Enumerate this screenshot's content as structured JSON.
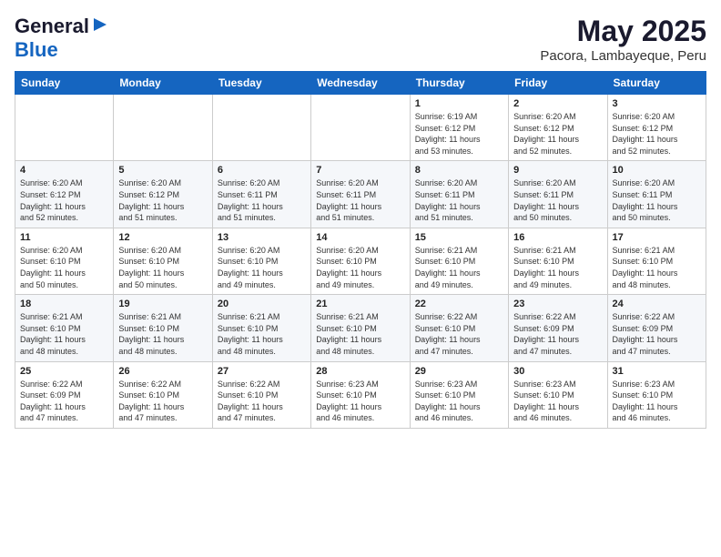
{
  "header": {
    "logo_line1": "General",
    "logo_line2": "Blue",
    "title": "May 2025",
    "subtitle": "Pacora, Lambayeque, Peru"
  },
  "days_of_week": [
    "Sunday",
    "Monday",
    "Tuesday",
    "Wednesday",
    "Thursday",
    "Friday",
    "Saturday"
  ],
  "weeks": [
    [
      {
        "day": "",
        "info": ""
      },
      {
        "day": "",
        "info": ""
      },
      {
        "day": "",
        "info": ""
      },
      {
        "day": "",
        "info": ""
      },
      {
        "day": "1",
        "info": "Sunrise: 6:19 AM\nSunset: 6:12 PM\nDaylight: 11 hours\nand 53 minutes."
      },
      {
        "day": "2",
        "info": "Sunrise: 6:20 AM\nSunset: 6:12 PM\nDaylight: 11 hours\nand 52 minutes."
      },
      {
        "day": "3",
        "info": "Sunrise: 6:20 AM\nSunset: 6:12 PM\nDaylight: 11 hours\nand 52 minutes."
      }
    ],
    [
      {
        "day": "4",
        "info": "Sunrise: 6:20 AM\nSunset: 6:12 PM\nDaylight: 11 hours\nand 52 minutes."
      },
      {
        "day": "5",
        "info": "Sunrise: 6:20 AM\nSunset: 6:12 PM\nDaylight: 11 hours\nand 51 minutes."
      },
      {
        "day": "6",
        "info": "Sunrise: 6:20 AM\nSunset: 6:11 PM\nDaylight: 11 hours\nand 51 minutes."
      },
      {
        "day": "7",
        "info": "Sunrise: 6:20 AM\nSunset: 6:11 PM\nDaylight: 11 hours\nand 51 minutes."
      },
      {
        "day": "8",
        "info": "Sunrise: 6:20 AM\nSunset: 6:11 PM\nDaylight: 11 hours\nand 51 minutes."
      },
      {
        "day": "9",
        "info": "Sunrise: 6:20 AM\nSunset: 6:11 PM\nDaylight: 11 hours\nand 50 minutes."
      },
      {
        "day": "10",
        "info": "Sunrise: 6:20 AM\nSunset: 6:11 PM\nDaylight: 11 hours\nand 50 minutes."
      }
    ],
    [
      {
        "day": "11",
        "info": "Sunrise: 6:20 AM\nSunset: 6:10 PM\nDaylight: 11 hours\nand 50 minutes."
      },
      {
        "day": "12",
        "info": "Sunrise: 6:20 AM\nSunset: 6:10 PM\nDaylight: 11 hours\nand 50 minutes."
      },
      {
        "day": "13",
        "info": "Sunrise: 6:20 AM\nSunset: 6:10 PM\nDaylight: 11 hours\nand 49 minutes."
      },
      {
        "day": "14",
        "info": "Sunrise: 6:20 AM\nSunset: 6:10 PM\nDaylight: 11 hours\nand 49 minutes."
      },
      {
        "day": "15",
        "info": "Sunrise: 6:21 AM\nSunset: 6:10 PM\nDaylight: 11 hours\nand 49 minutes."
      },
      {
        "day": "16",
        "info": "Sunrise: 6:21 AM\nSunset: 6:10 PM\nDaylight: 11 hours\nand 49 minutes."
      },
      {
        "day": "17",
        "info": "Sunrise: 6:21 AM\nSunset: 6:10 PM\nDaylight: 11 hours\nand 48 minutes."
      }
    ],
    [
      {
        "day": "18",
        "info": "Sunrise: 6:21 AM\nSunset: 6:10 PM\nDaylight: 11 hours\nand 48 minutes."
      },
      {
        "day": "19",
        "info": "Sunrise: 6:21 AM\nSunset: 6:10 PM\nDaylight: 11 hours\nand 48 minutes."
      },
      {
        "day": "20",
        "info": "Sunrise: 6:21 AM\nSunset: 6:10 PM\nDaylight: 11 hours\nand 48 minutes."
      },
      {
        "day": "21",
        "info": "Sunrise: 6:21 AM\nSunset: 6:10 PM\nDaylight: 11 hours\nand 48 minutes."
      },
      {
        "day": "22",
        "info": "Sunrise: 6:22 AM\nSunset: 6:10 PM\nDaylight: 11 hours\nand 47 minutes."
      },
      {
        "day": "23",
        "info": "Sunrise: 6:22 AM\nSunset: 6:09 PM\nDaylight: 11 hours\nand 47 minutes."
      },
      {
        "day": "24",
        "info": "Sunrise: 6:22 AM\nSunset: 6:09 PM\nDaylight: 11 hours\nand 47 minutes."
      }
    ],
    [
      {
        "day": "25",
        "info": "Sunrise: 6:22 AM\nSunset: 6:09 PM\nDaylight: 11 hours\nand 47 minutes."
      },
      {
        "day": "26",
        "info": "Sunrise: 6:22 AM\nSunset: 6:10 PM\nDaylight: 11 hours\nand 47 minutes."
      },
      {
        "day": "27",
        "info": "Sunrise: 6:22 AM\nSunset: 6:10 PM\nDaylight: 11 hours\nand 47 minutes."
      },
      {
        "day": "28",
        "info": "Sunrise: 6:23 AM\nSunset: 6:10 PM\nDaylight: 11 hours\nand 46 minutes."
      },
      {
        "day": "29",
        "info": "Sunrise: 6:23 AM\nSunset: 6:10 PM\nDaylight: 11 hours\nand 46 minutes."
      },
      {
        "day": "30",
        "info": "Sunrise: 6:23 AM\nSunset: 6:10 PM\nDaylight: 11 hours\nand 46 minutes."
      },
      {
        "day": "31",
        "info": "Sunrise: 6:23 AM\nSunset: 6:10 PM\nDaylight: 11 hours\nand 46 minutes."
      }
    ]
  ]
}
